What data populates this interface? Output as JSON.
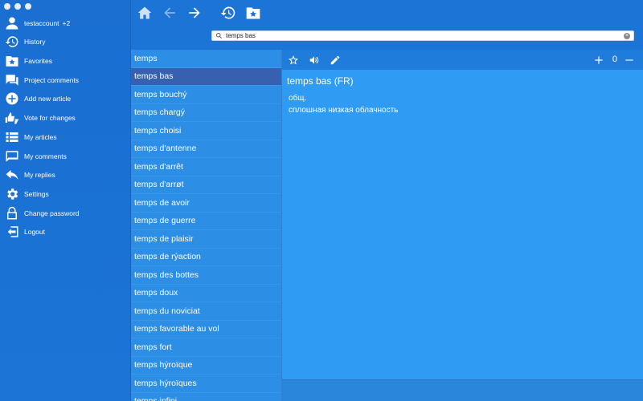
{
  "sidebar": {
    "account": {
      "name": "testaccount",
      "extra": "+2"
    },
    "items": [
      {
        "label": "History",
        "icon": "history-icon"
      },
      {
        "label": "Favorites",
        "icon": "favorites-folder-icon"
      },
      {
        "label": "Project comments",
        "icon": "comments-icon"
      },
      {
        "label": "Add new article",
        "icon": "add-circle-icon"
      },
      {
        "label": "Vote for changes",
        "icon": "thumbs-icon"
      },
      {
        "label": "My articles",
        "icon": "list-icon"
      },
      {
        "label": "My comments",
        "icon": "comment-icon"
      },
      {
        "label": "My replies",
        "icon": "reply-icon"
      },
      {
        "label": "Settings",
        "icon": "gear-icon"
      },
      {
        "label": "Change password",
        "icon": "lock-icon"
      },
      {
        "label": "Logout",
        "icon": "logout-icon"
      }
    ]
  },
  "search": {
    "value": "temps bas"
  },
  "wordlist": [
    "temps",
    "temps bas",
    "temps bouchý",
    "temps chargý",
    "temps choisi",
    "temps d'antenne",
    "temps d'arrêt",
    "temps d'arrøt",
    "temps de avoir",
    "temps de guerre",
    "temps de plaisir",
    "temps de rýaction",
    "temps des bottes",
    "temps doux",
    "temps du noviciat",
    "temps favorable au vol",
    "temps fort",
    "temps hýroïque",
    "temps hýroïques",
    "temps infini"
  ],
  "selected_index": 1,
  "article": {
    "title": "temps bas (FR)",
    "gloss": "общ.",
    "translation": "сплошная низкая облачность",
    "count": "0"
  },
  "colors": {
    "accent": "#1b74d6",
    "selected": "#3661b0"
  }
}
